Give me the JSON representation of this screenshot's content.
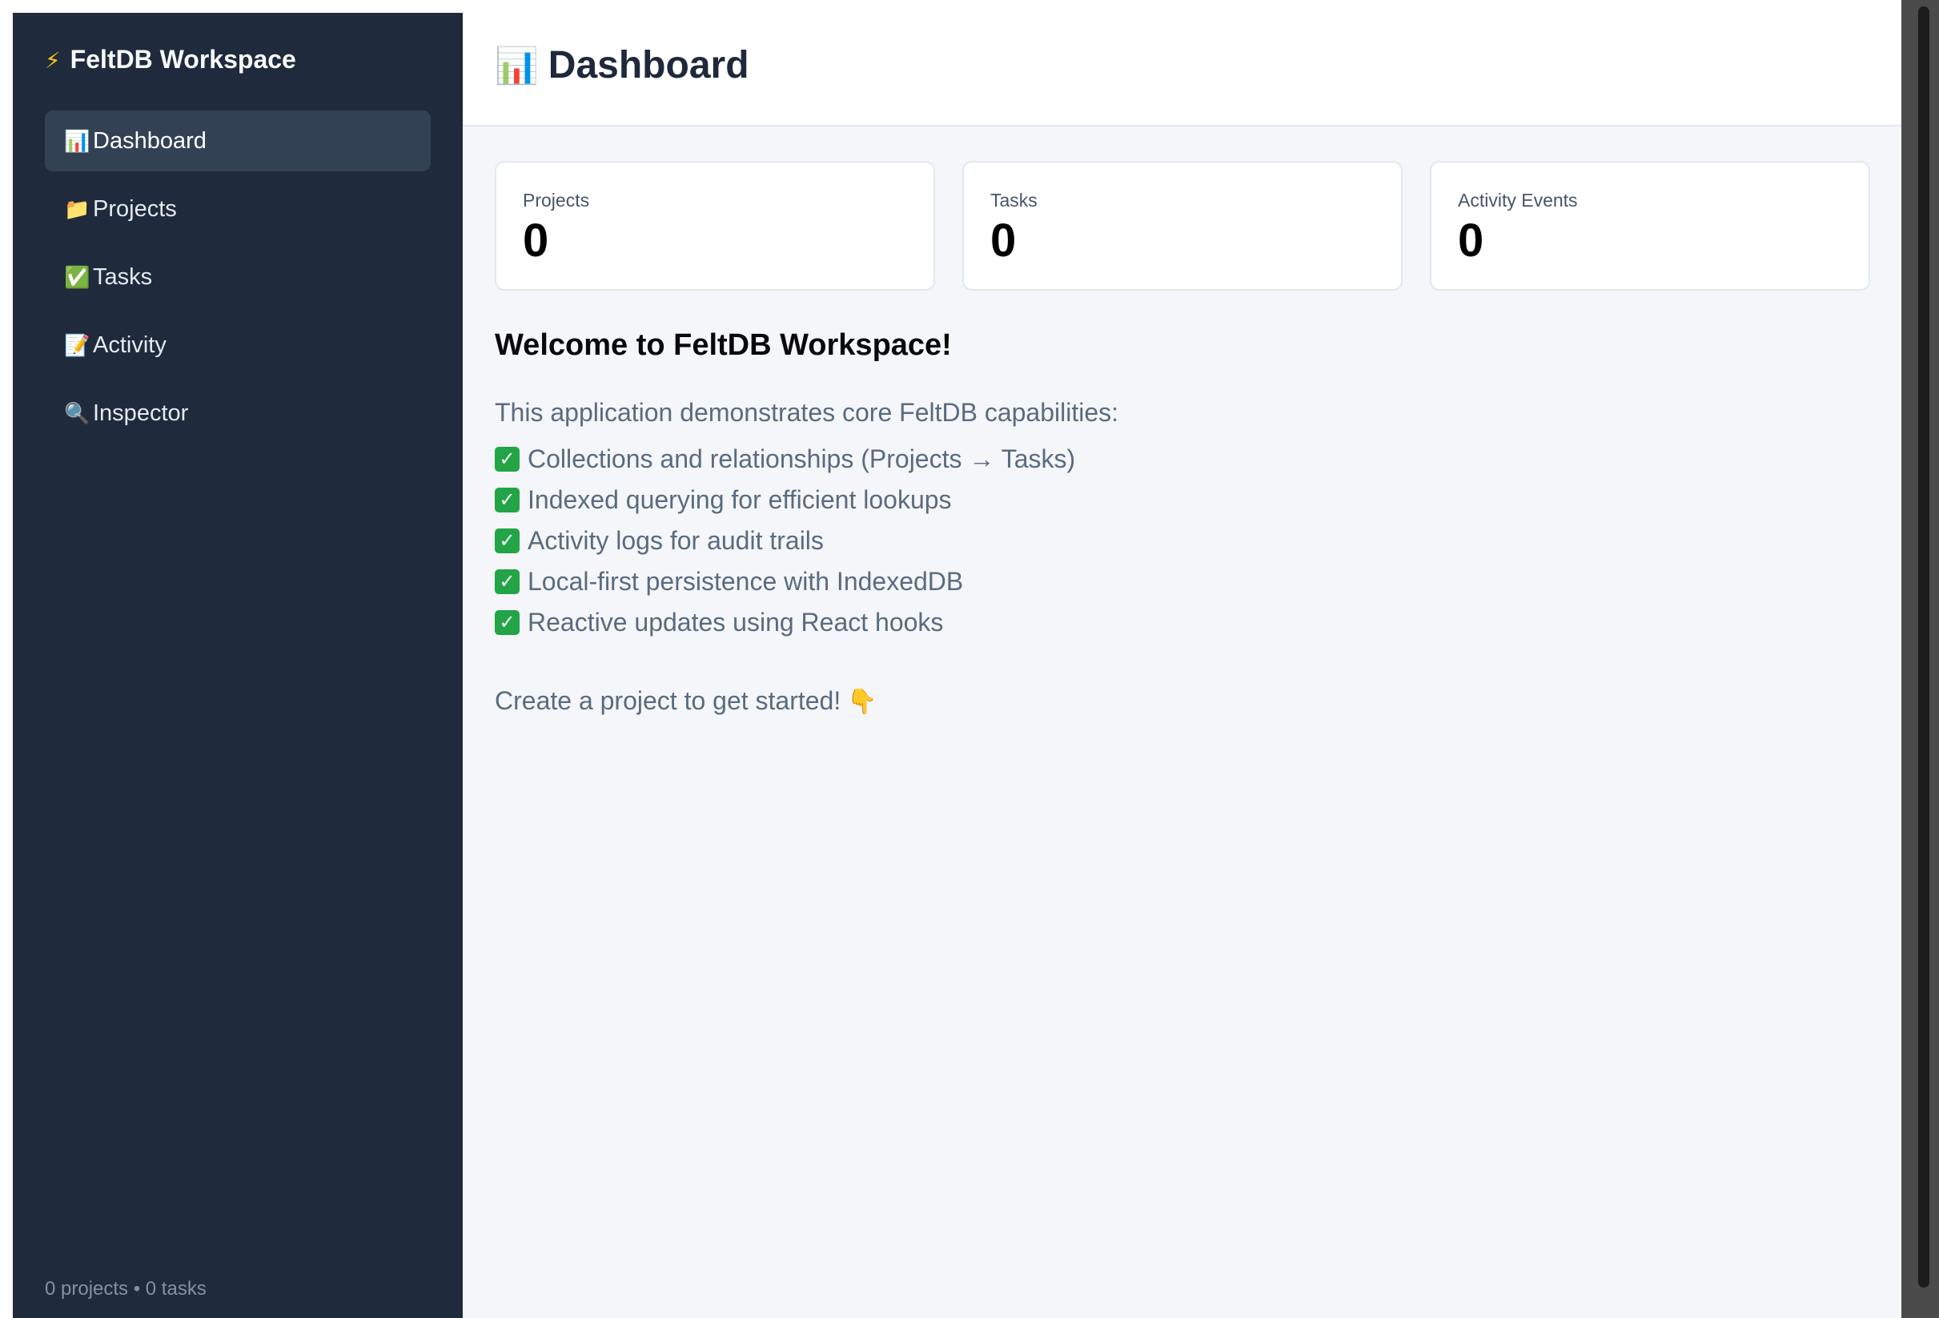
{
  "sidebar": {
    "brand_icon": "⚡",
    "brand_title": "FeltDB Workspace",
    "items": [
      {
        "icon": "📊",
        "label": "Dashboard",
        "active": true
      },
      {
        "icon": "📁",
        "label": "Projects",
        "active": false
      },
      {
        "icon": "✅",
        "label": "Tasks",
        "active": false
      },
      {
        "icon": "📝",
        "label": "Activity",
        "active": false
      },
      {
        "icon": "🔍",
        "label": "Inspector",
        "active": false
      }
    ],
    "footer": "0 projects • 0 tasks"
  },
  "header": {
    "icon": "📊",
    "title": "Dashboard"
  },
  "stats": [
    {
      "label": "Projects",
      "value": "0"
    },
    {
      "label": "Tasks",
      "value": "0"
    },
    {
      "label": "Activity Events",
      "value": "0"
    }
  ],
  "welcome": {
    "title": "Welcome to FeltDB Workspace!",
    "intro": "This application demonstrates core FeltDB capabilities:",
    "check_icon": "✓",
    "features": [
      "Collections and relationships (Projects → Tasks)",
      "Indexed querying for efficient lookups",
      "Activity logs for audit trails",
      "Local-first persistence with IndexedDB",
      "Reactive updates using React hooks"
    ],
    "cta": "Create a project to get started!",
    "cta_icon": "👇"
  },
  "colors": {
    "sidebar_bg": "#1f2a3c",
    "active_item_bg": "#334155",
    "main_bg": "#f4f6f9",
    "check_green": "#22a447"
  }
}
